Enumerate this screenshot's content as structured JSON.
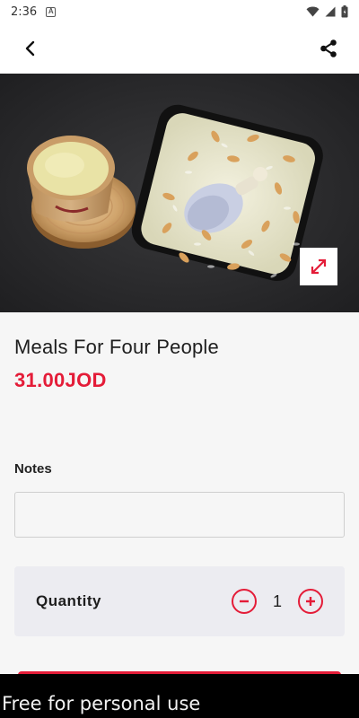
{
  "status_bar": {
    "time": "2:36",
    "notification_icon": "a-icon",
    "wifi_icon": "wifi-icon",
    "signal_icon": "signal-icon",
    "battery_icon": "battery-icon"
  },
  "app_bar": {
    "back_icon": "chevron-left-icon",
    "share_icon": "share-icon"
  },
  "hero": {
    "expand_icon": "expand-icon",
    "accent_color": "#e41c38"
  },
  "product": {
    "title": "Meals For Four People",
    "price": "31.00JOD"
  },
  "notes": {
    "label": "Notes",
    "value": "",
    "placeholder": ""
  },
  "quantity": {
    "label": "Quantity",
    "value": "1",
    "decrement_icon": "minus-circle-icon",
    "increment_icon": "plus-circle-icon"
  },
  "watermark": "Free for personal use",
  "colors": {
    "accent": "#e41c38",
    "background": "#f6f6f6",
    "card": "#ececf1"
  }
}
